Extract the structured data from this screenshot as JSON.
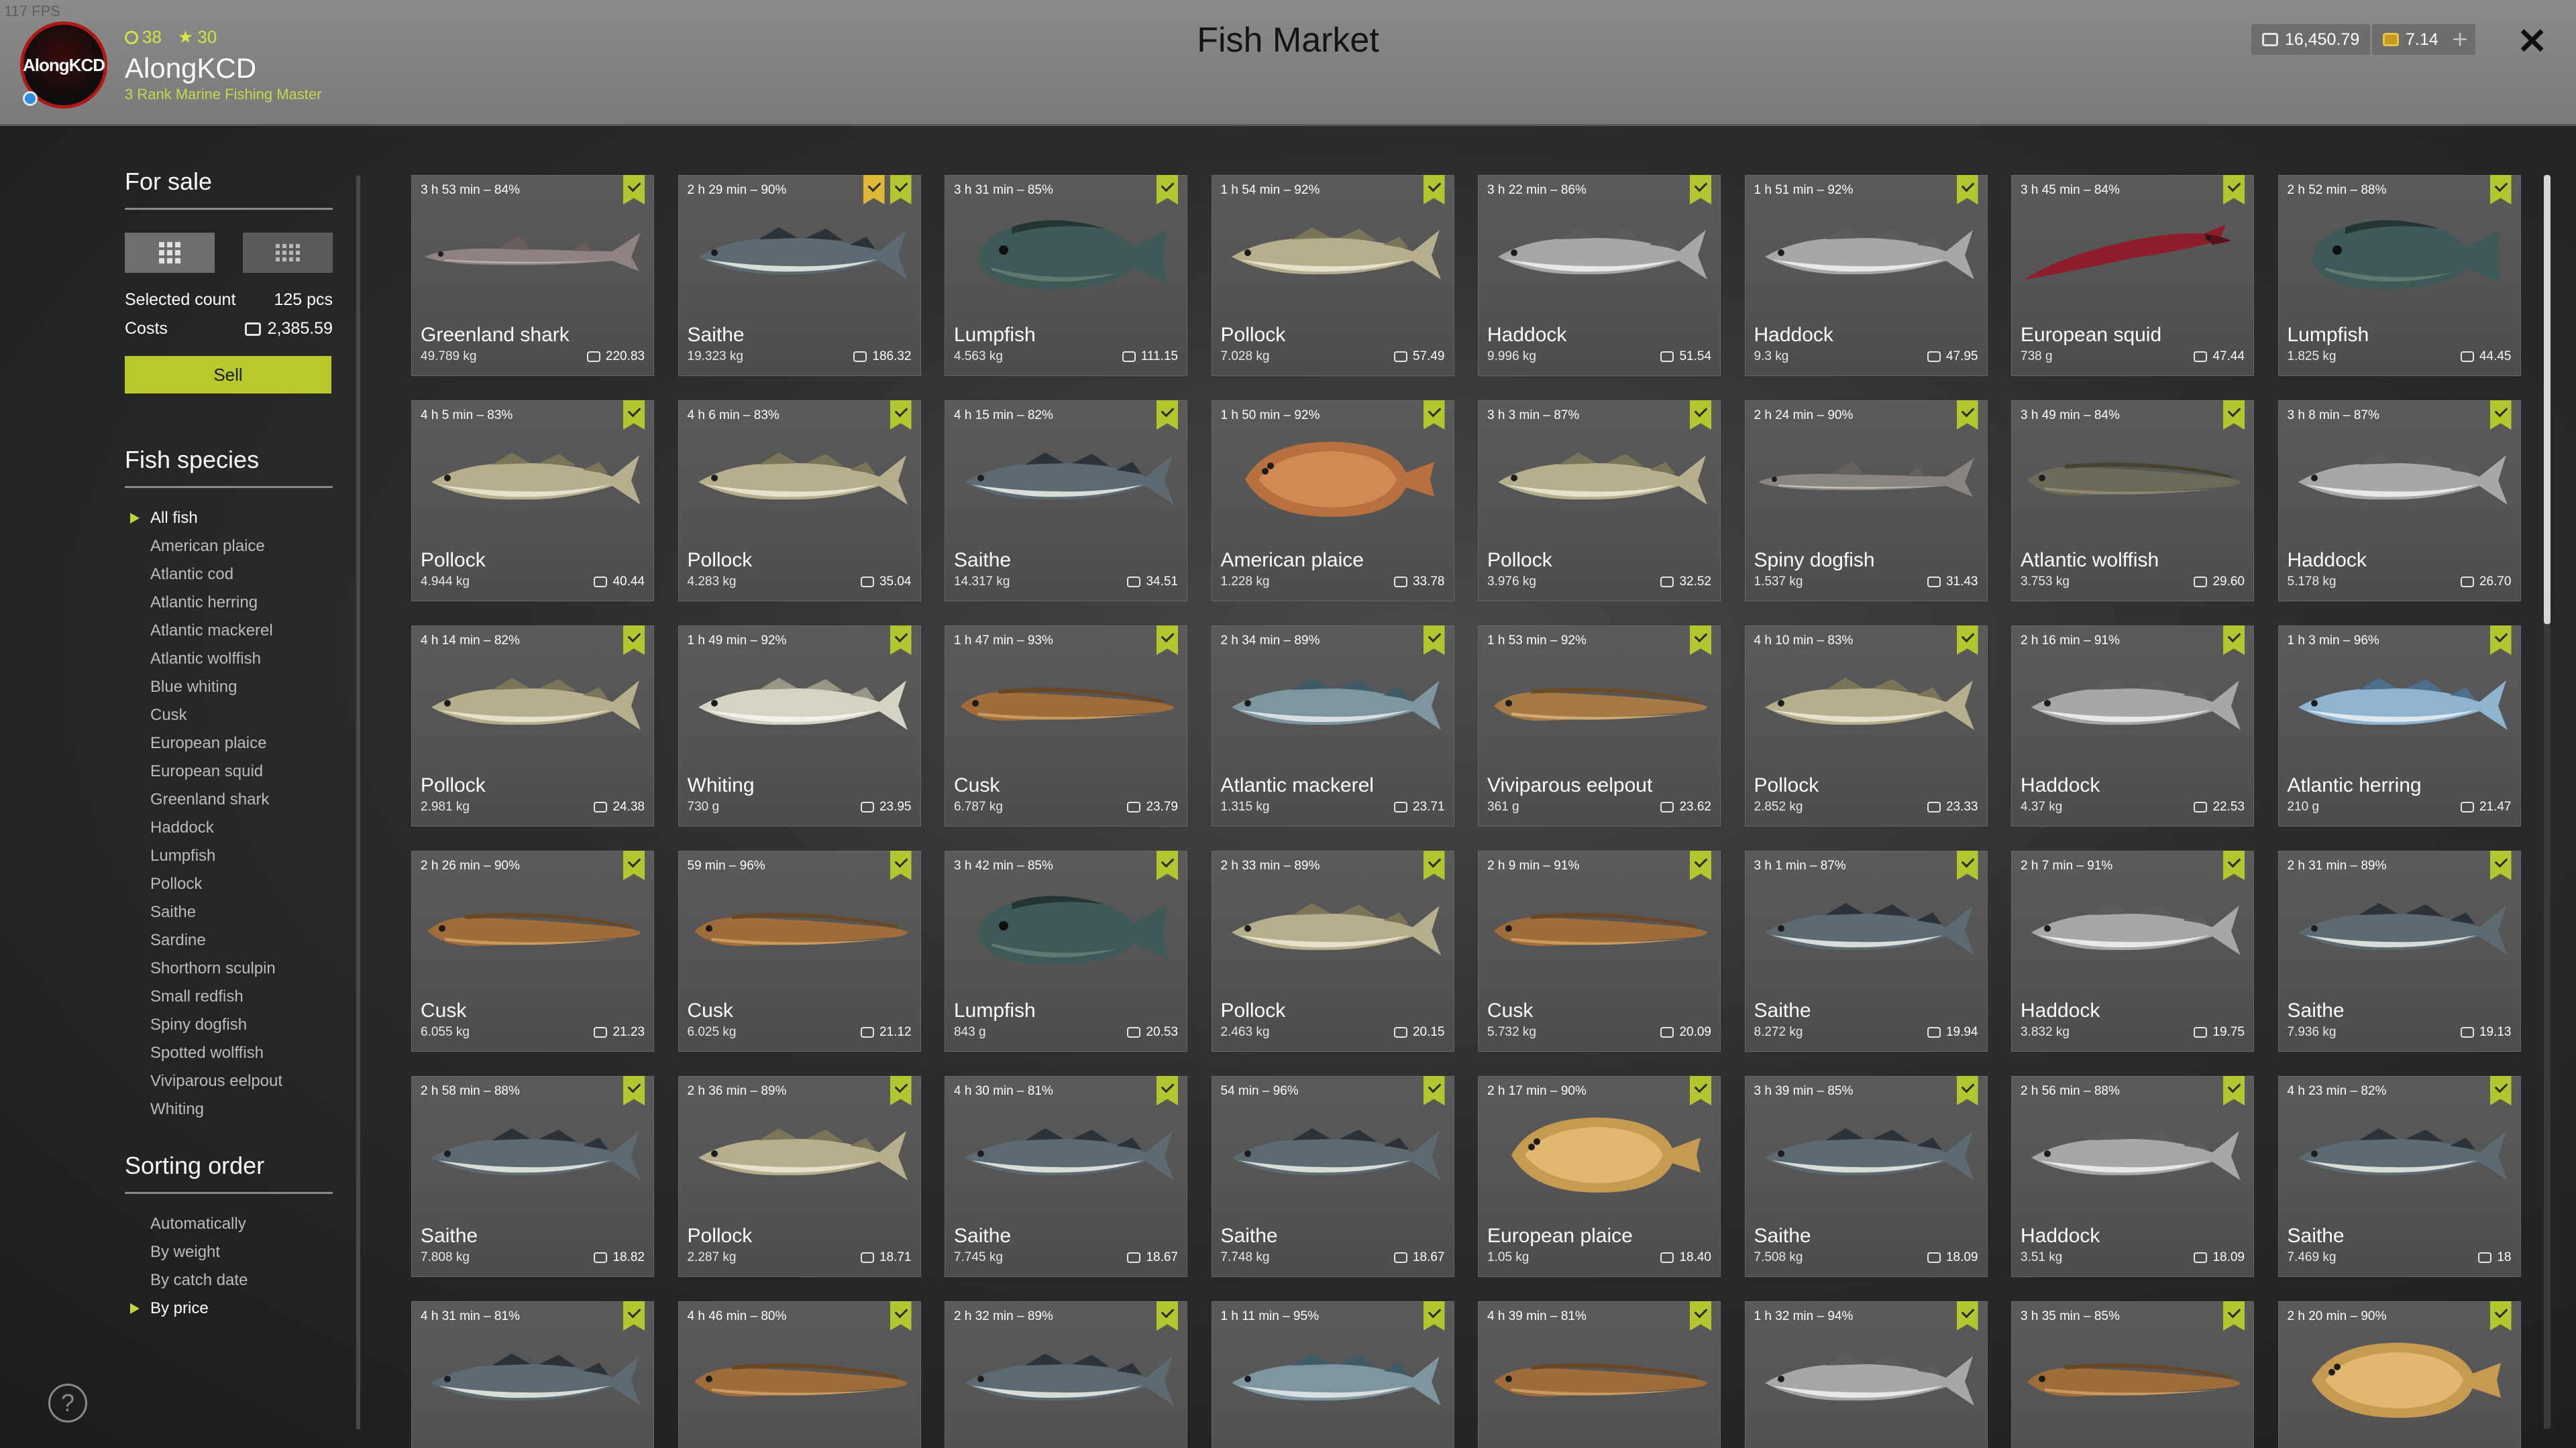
{
  "fps": "117 FPS",
  "player": {
    "name": "AlongKCD",
    "avatar_text": "AlongKCD",
    "rank": "3 Rank Marine Fishing Master",
    "level": "38",
    "stars": "30"
  },
  "title": "Fish Market",
  "currency": {
    "silver": "16,450.79",
    "gold": "7.14",
    "add": "+"
  },
  "close": "✕",
  "sale": {
    "title": "For sale",
    "selected_label": "Selected count",
    "selected_value": "125 pcs",
    "costs_label": "Costs",
    "costs_value": "2,385.59",
    "sell": "Sell"
  },
  "species": {
    "title": "Fish species",
    "items": [
      "All fish",
      "American plaice",
      "Atlantic cod",
      "Atlantic herring",
      "Atlantic mackerel",
      "Atlantic wolffish",
      "Blue whiting",
      "Cusk",
      "European plaice",
      "European squid",
      "Greenland shark",
      "Haddock",
      "Lumpfish",
      "Pollock",
      "Saithe",
      "Sardine",
      "Shorthorn sculpin",
      "Small redfish",
      "Spiny dogfish",
      "Spotted wolffish",
      "Viviparous eelpout",
      "Whiting"
    ],
    "selected": "All fish"
  },
  "sorting": {
    "title": "Sorting order",
    "items": [
      "Automatically",
      "By weight",
      "By catch date",
      "By price"
    ],
    "selected": "By price"
  },
  "help": "?",
  "colors": {
    "accent": "#b8c92c",
    "flag_gold": "#e0b838",
    "header": "#828282"
  },
  "fish": [
    {
      "meta": "3 h 53 min – 84%",
      "name": "Greenland shark",
      "weight": "49.789 kg",
      "price": "220.83",
      "kind": "shark"
    },
    {
      "meta": "2 h 29 min – 90%",
      "name": "Saithe",
      "weight": "19.323 kg",
      "price": "186.32",
      "kind": "saithe",
      "gold": true
    },
    {
      "meta": "3 h 31 min – 85%",
      "name": "Lumpfish",
      "weight": "4.563 kg",
      "price": "111.15",
      "kind": "lumpfish"
    },
    {
      "meta": "1 h 54 min – 92%",
      "name": "Pollock",
      "weight": "7.028 kg",
      "price": "57.49",
      "kind": "pollock"
    },
    {
      "meta": "3 h 22 min – 86%",
      "name": "Haddock",
      "weight": "9.996 kg",
      "price": "51.54",
      "kind": "haddock"
    },
    {
      "meta": "1 h 51 min – 92%",
      "name": "Haddock",
      "weight": "9.3 kg",
      "price": "47.95",
      "kind": "haddock"
    },
    {
      "meta": "3 h 45 min – 84%",
      "name": "European squid",
      "weight": "738 g",
      "price": "47.44",
      "kind": "squid"
    },
    {
      "meta": "2 h 52 min – 88%",
      "name": "Lumpfish",
      "weight": "1.825 kg",
      "price": "44.45",
      "kind": "lumpfish"
    },
    {
      "meta": "4 h 5 min – 83%",
      "name": "Pollock",
      "weight": "4.944 kg",
      "price": "40.44",
      "kind": "pollock"
    },
    {
      "meta": "4 h 6 min – 83%",
      "name": "Pollock",
      "weight": "4.283 kg",
      "price": "35.04",
      "kind": "pollock"
    },
    {
      "meta": "4 h 15 min – 82%",
      "name": "Saithe",
      "weight": "14.317 kg",
      "price": "34.51",
      "kind": "saithe"
    },
    {
      "meta": "1 h 50 min – 92%",
      "name": "American plaice",
      "weight": "1.228 kg",
      "price": "33.78",
      "kind": "plaice"
    },
    {
      "meta": "3 h 3 min – 87%",
      "name": "Pollock",
      "weight": "3.976 kg",
      "price": "32.52",
      "kind": "pollock"
    },
    {
      "meta": "2 h 24 min – 90%",
      "name": "Spiny dogfish",
      "weight": "1.537 kg",
      "price": "31.43",
      "kind": "dogfish"
    },
    {
      "meta": "3 h 49 min – 84%",
      "name": "Atlantic wolffish",
      "weight": "3.753 kg",
      "price": "29.60",
      "kind": "wolffish"
    },
    {
      "meta": "3 h 8 min – 87%",
      "name": "Haddock",
      "weight": "5.178 kg",
      "price": "26.70",
      "kind": "haddock"
    },
    {
      "meta": "4 h 14 min – 82%",
      "name": "Pollock",
      "weight": "2.981 kg",
      "price": "24.38",
      "kind": "pollock"
    },
    {
      "meta": "1 h 49 min – 92%",
      "name": "Whiting",
      "weight": "730 g",
      "price": "23.95",
      "kind": "whiting"
    },
    {
      "meta": "1 h 47 min – 93%",
      "name": "Cusk",
      "weight": "6.787 kg",
      "price": "23.79",
      "kind": "cusk"
    },
    {
      "meta": "2 h 34 min – 89%",
      "name": "Atlantic mackerel",
      "weight": "1.315 kg",
      "price": "23.71",
      "kind": "mackerel"
    },
    {
      "meta": "1 h 53 min – 92%",
      "name": "Viviparous eelpout",
      "weight": "361 g",
      "price": "23.62",
      "kind": "eelpout"
    },
    {
      "meta": "4 h 10 min – 83%",
      "name": "Pollock",
      "weight": "2.852 kg",
      "price": "23.33",
      "kind": "pollock"
    },
    {
      "meta": "2 h 16 min – 91%",
      "name": "Haddock",
      "weight": "4.37 kg",
      "price": "22.53",
      "kind": "haddock"
    },
    {
      "meta": "1 h 3 min – 96%",
      "name": "Atlantic herring",
      "weight": "210 g",
      "price": "21.47",
      "kind": "herring"
    },
    {
      "meta": "2 h 26 min – 90%",
      "name": "Cusk",
      "weight": "6.055 kg",
      "price": "21.23",
      "kind": "cusk"
    },
    {
      "meta": "59 min – 96%",
      "name": "Cusk",
      "weight": "6.025 kg",
      "price": "21.12",
      "kind": "cusk"
    },
    {
      "meta": "3 h 42 min – 85%",
      "name": "Lumpfish",
      "weight": "843 g",
      "price": "20.53",
      "kind": "lumpfish"
    },
    {
      "meta": "2 h 33 min – 89%",
      "name": "Pollock",
      "weight": "2.463 kg",
      "price": "20.15",
      "kind": "pollock"
    },
    {
      "meta": "2 h 9 min – 91%",
      "name": "Cusk",
      "weight": "5.732 kg",
      "price": "20.09",
      "kind": "cusk"
    },
    {
      "meta": "3 h 1 min – 87%",
      "name": "Saithe",
      "weight": "8.272 kg",
      "price": "19.94",
      "kind": "saithe"
    },
    {
      "meta": "2 h 7 min – 91%",
      "name": "Haddock",
      "weight": "3.832 kg",
      "price": "19.75",
      "kind": "haddock"
    },
    {
      "meta": "2 h 31 min – 89%",
      "name": "Saithe",
      "weight": "7.936 kg",
      "price": "19.13",
      "kind": "saithe"
    },
    {
      "meta": "2 h 58 min – 88%",
      "name": "Saithe",
      "weight": "7.808 kg",
      "price": "18.82",
      "kind": "saithe"
    },
    {
      "meta": "2 h 36 min – 89%",
      "name": "Pollock",
      "weight": "2.287 kg",
      "price": "18.71",
      "kind": "pollock"
    },
    {
      "meta": "4 h 30 min – 81%",
      "name": "Saithe",
      "weight": "7.745 kg",
      "price": "18.67",
      "kind": "saithe"
    },
    {
      "meta": "54 min – 96%",
      "name": "Saithe",
      "weight": "7.748 kg",
      "price": "18.67",
      "kind": "saithe"
    },
    {
      "meta": "2 h 17 min – 90%",
      "name": "European plaice",
      "weight": "1.05 kg",
      "price": "18.40",
      "kind": "euplaice"
    },
    {
      "meta": "3 h 39 min – 85%",
      "name": "Saithe",
      "weight": "7.508 kg",
      "price": "18.09",
      "kind": "saithe"
    },
    {
      "meta": "2 h 56 min – 88%",
      "name": "Haddock",
      "weight": "3.51 kg",
      "price": "18.09",
      "kind": "haddock"
    },
    {
      "meta": "4 h 23 min – 82%",
      "name": "Saithe",
      "weight": "7.469 kg",
      "price": "18",
      "kind": "saithe"
    },
    {
      "meta": "4 h 31 min – 81%",
      "kind": "saithe"
    },
    {
      "meta": "4 h 46 min – 80%",
      "kind": "cusk"
    },
    {
      "meta": "2 h 32 min – 89%",
      "kind": "saithe"
    },
    {
      "meta": "1 h 11 min – 95%",
      "kind": "mackerel"
    },
    {
      "meta": "4 h 39 min – 81%",
      "kind": "cusk"
    },
    {
      "meta": "1 h 32 min – 94%",
      "kind": "haddock"
    },
    {
      "meta": "3 h 35 min – 85%",
      "kind": "cusk"
    },
    {
      "meta": "2 h 20 min – 90%",
      "kind": "euplaice"
    }
  ]
}
